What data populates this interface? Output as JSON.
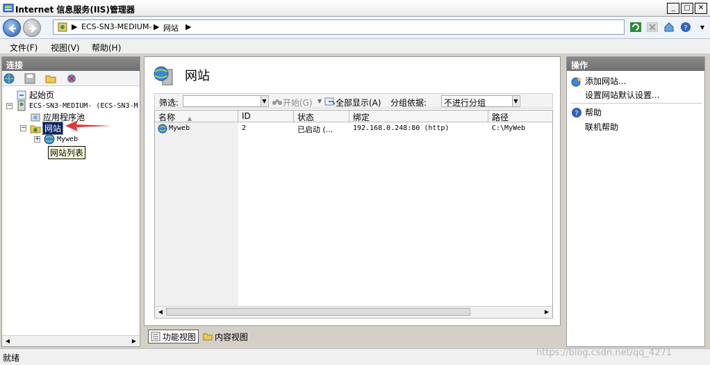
{
  "window": {
    "title": "Internet 信息服务(IIS)管理器",
    "buttons": [
      "_",
      "□",
      "✕"
    ]
  },
  "address": {
    "crumbs": [
      "ECS-SN3-MEDIUM-",
      "网站"
    ],
    "separator": "▶"
  },
  "menubar": {
    "items": [
      "文件(F)",
      "视图(V)",
      "帮助(H)"
    ]
  },
  "connections": {
    "header": "连接",
    "tree": {
      "start_page": "起始页",
      "server": "ECS-SN3-MEDIUM- (ECS-SN3-M",
      "app_pools": "应用程序池",
      "sites": "网站",
      "site_myweb": "Myweb",
      "tooltip": "网站列表"
    }
  },
  "main": {
    "title": "网站",
    "filter": {
      "label": "筛选:",
      "start_label": "开始(G)",
      "show_all_label": "全部显示(A)",
      "group_by_label": "分组依据:",
      "group_value": "不进行分组"
    },
    "columns": [
      "名称",
      "ID",
      "状态",
      "绑定",
      "路径"
    ],
    "rows": [
      {
        "name": "Myweb",
        "id": "2",
        "status": "已启动 (...",
        "binding": "192.168.0.248:80 (http)",
        "path": "C:\\MyWeb"
      }
    ],
    "view_tabs": [
      "功能视图",
      "内容视图"
    ]
  },
  "actions": {
    "header": "操作",
    "items": [
      "添加网站...",
      "设置网站默认设置...",
      "帮助",
      "联机帮助"
    ]
  },
  "status": {
    "text": "就绪"
  },
  "watermark": "https://blog.csdn.net/qq_4271",
  "colors": {
    "selection": "#0a246a",
    "panel_header": "#7a7a7a",
    "arrow": "#e03a3a"
  }
}
